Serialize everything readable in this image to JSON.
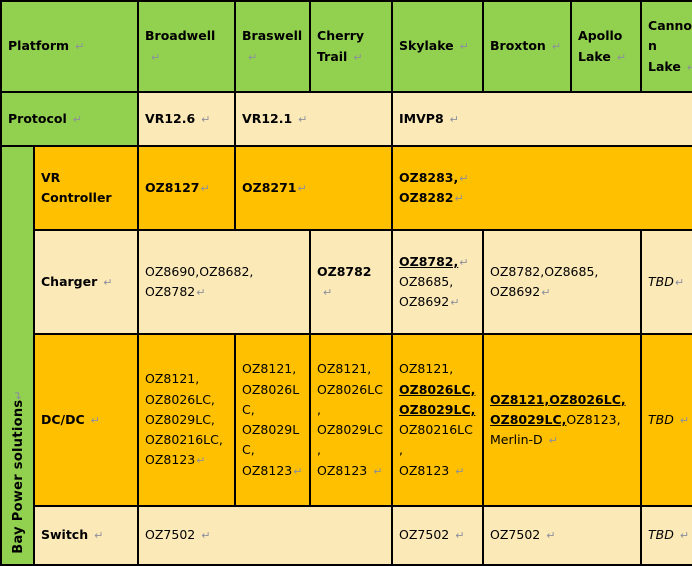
{
  "table": {
    "colors": {
      "green": "#92D050",
      "orange": "#FFC000",
      "cream": "#FCE9B8",
      "border": "#000000",
      "pilcrow": "#8C8F9C"
    },
    "row_label_vertical": "Bay Power solutions",
    "pilcrow_glyph": "↵",
    "header": {
      "platform_label": "Platform",
      "columns": [
        "Broadwell",
        "Braswell",
        "Cherry Trail",
        "Skylake",
        "Broxton",
        "Apollo Lake",
        "Cannon Lake"
      ]
    },
    "protocol": {
      "label": "Protocol",
      "broadwell": "VR12.6",
      "braswell_cherrytrail": "VR12.1",
      "skylake_to_cannon": "IMVP8"
    },
    "vr_controller": {
      "label_line1": "VR",
      "label_line2": "Controller",
      "broadwell": "OZ8127",
      "braswell": "OZ8271",
      "skylake_line1": "OZ8283,",
      "skylake_line2": "OZ8282"
    },
    "charger": {
      "label": "Charger",
      "broadwell_braswell_line1a": "OZ8690,",
      "broadwell_braswell_line1b": "OZ8682,",
      "broadwell_braswell_line2": "OZ8782",
      "cherry_trail": "OZ8782",
      "skylake_line1": "OZ8782,",
      "skylake_line2": "OZ8685,",
      "skylake_line3": "OZ8692",
      "broxton_apollo_line1a": "OZ8782,",
      "broxton_apollo_line1b": "OZ8685,",
      "broxton_apollo_line2": "OZ8692",
      "cannon_lake": "TBD"
    },
    "dcdc": {
      "label": "DC/DC",
      "broadwell": [
        "OZ8121,",
        "OZ8026LC,",
        "OZ8029LC,",
        "OZ80216LC,",
        "OZ8123"
      ],
      "braswell": [
        "OZ8121,",
        "OZ8026LC,",
        "OZ8029LC,",
        "OZ8123"
      ],
      "cherry_trail": [
        "OZ8121,",
        "OZ8026LC,",
        "OZ8029LC,",
        "OZ8123"
      ],
      "skylake": [
        "OZ8121,",
        "OZ8026LC,",
        "OZ8029LC,",
        "OZ80216LC,",
        "OZ8123"
      ],
      "broxton_apollo_line1a": "OZ8121,",
      "broxton_apollo_line1b": "OZ8026LC,",
      "broxton_apollo_line2a": "OZ8029LC,",
      "broxton_apollo_line2b": "OZ8123,",
      "broxton_apollo_line3": "Merlin-D",
      "cannon_lake": "TBD"
    },
    "switch": {
      "label": "Switch",
      "broadwell_to_cherrytrail": "OZ7502",
      "skylake": "OZ7502",
      "broxton_apollo": "OZ7502",
      "cannon_lake": "TBD"
    }
  }
}
